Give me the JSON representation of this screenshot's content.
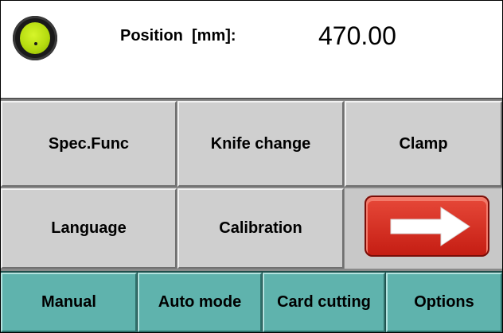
{
  "header": {
    "position_label": "Position  [mm]:",
    "position_value": "470.00",
    "status_light_color": "#c6e817"
  },
  "row1": {
    "spec_func": "Spec.Func",
    "knife_change": "Knife change",
    "clamp": "Clamp"
  },
  "row2": {
    "language": "Language",
    "calibration": "Calibration",
    "next_icon": "arrow-right-icon",
    "next_color": "#d62a1e"
  },
  "nav": {
    "manual": "Manual",
    "auto_mode": "Auto mode",
    "card_cutting": "Card cutting",
    "options": "Options",
    "color": "#5fb3ad"
  }
}
